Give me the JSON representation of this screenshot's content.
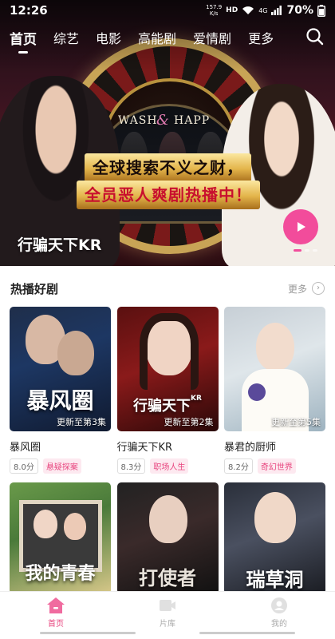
{
  "status_bar": {
    "time": "12:26",
    "speed_value": "157.9",
    "speed_unit": "K/s",
    "hd": "HD",
    "network": "4G",
    "battery": "70%"
  },
  "top_nav": {
    "tabs": [
      {
        "label": "首页",
        "active": true
      },
      {
        "label": "综艺",
        "active": false
      },
      {
        "label": "电影",
        "active": false
      },
      {
        "label": "高能剧",
        "active": false
      },
      {
        "label": "爱情剧",
        "active": false
      },
      {
        "label": "更多",
        "active": false
      }
    ],
    "search_icon": "search-icon"
  },
  "hero": {
    "title": "行骗天下KR",
    "poster_text_1": "WASH",
    "poster_text_amp": "&",
    "poster_text_2": "HAPP",
    "tagline_1": "全球搜索不义之财，",
    "tagline_2": "全员恶人爽剧热播中！",
    "play_icon": "play-icon",
    "slide_count": 3,
    "active_slide": 1
  },
  "hot_section": {
    "title": "热播好剧",
    "more_label": "更多",
    "items": [
      {
        "title": "暴风圈",
        "poster_text": "暴风圈",
        "episode": "更新至第3集",
        "score": "8.0分",
        "genre": "悬疑探案"
      },
      {
        "title": "行骗天下KR",
        "poster_text": "行骗天下",
        "poster_text_suffix": "KR",
        "episode": "更新至第2集",
        "score": "8.3分",
        "genre": "职场人生"
      },
      {
        "title": "暴君的厨师",
        "episode": "更新至第5集",
        "score": "8.2分",
        "genre": "奇幻世界"
      },
      {
        "poster_text": "我的青春"
      },
      {
        "poster_text": "打使者"
      },
      {
        "poster_text": "瑞草洞"
      }
    ]
  },
  "tab_bar": {
    "items": [
      {
        "label": "首页",
        "icon": "home-icon",
        "active": true
      },
      {
        "label": "片库",
        "icon": "video-icon",
        "active": false
      },
      {
        "label": "我的",
        "icon": "profile-icon",
        "active": false
      }
    ]
  },
  "colors": {
    "accent": "#e8467f",
    "play_button": "#f24c9b"
  }
}
